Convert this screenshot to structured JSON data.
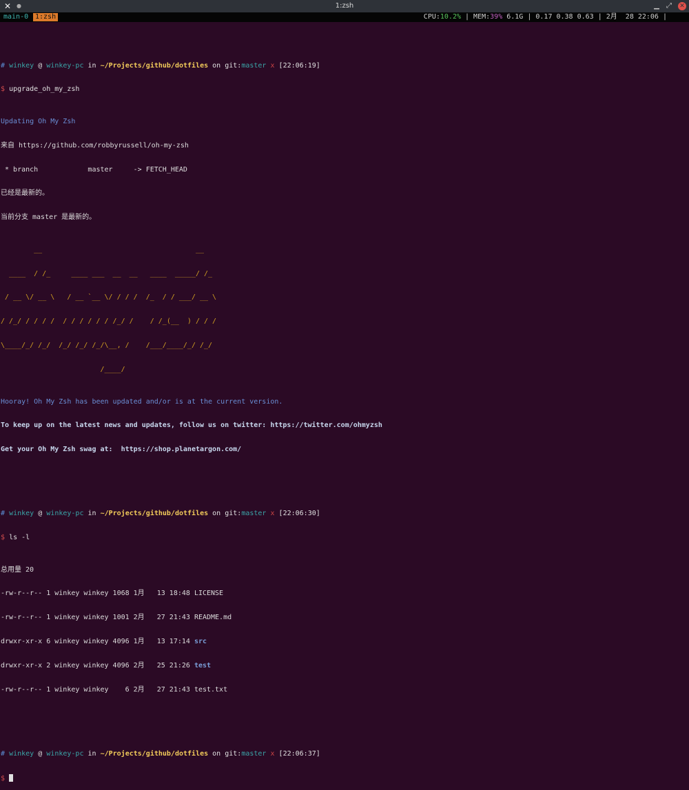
{
  "window": {
    "title": "1:zsh",
    "app_icon": "close-x-icon",
    "pin_icon": "dot-icon",
    "controls": [
      "minimize-icon",
      "restore-icon",
      "close-icon"
    ]
  },
  "tmux": {
    "session": "main-0",
    "window": "1:zsh",
    "cpu_label": "CPU:",
    "cpu_value": "10.2%",
    "mem_label": " | MEM:",
    "mem_value": "39%",
    "rest": " 6.1G | 0.17 0.38 0.63 | 2月  28 22:06 |"
  },
  "prompts": [
    {
      "hash": "#",
      "user": "winkey",
      "at": "@",
      "host": "winkey-pc",
      "in": "in",
      "path": "~/Projects/github/dotfiles",
      "on": "on",
      "git": "git:",
      "branch": "master",
      "dirty": "x",
      "time": "[22:06:19]",
      "cmd": "upgrade_oh_my_zsh"
    },
    {
      "hash": "#",
      "user": "winkey",
      "at": "@",
      "host": "winkey-pc",
      "in": "in",
      "path": "~/Projects/github/dotfiles",
      "on": "on",
      "git": "git:",
      "branch": "master",
      "dirty": "x",
      "time": "[22:06:30]",
      "cmd": "ls -l"
    },
    {
      "hash": "#",
      "user": "winkey",
      "at": "@",
      "host": "winkey-pc",
      "in": "in",
      "path": "~/Projects/github/dotfiles",
      "on": "on",
      "git": "git:",
      "branch": "master",
      "dirty": "x",
      "time": "[22:06:37]",
      "cmd": ""
    }
  ],
  "prompt_char": "$",
  "upgrade": {
    "updating": "Updating Oh My Zsh",
    "from": "来自 https://github.com/robbyrussell/oh-my-zsh",
    "branch": " * branch            master     -> FETCH_HEAD",
    "latest": "已经是最新的。",
    "current": "当前分支 master 是最新的。",
    "ascii": [
      "        __                                     __",
      "  ____  / /_     ____ ___  __  __   ____  _____/ /_",
      " / __ \\/ __ \\   / __ `__ \\/ / / /  /_  / / ___/ __ \\",
      "/ /_/ / / / /  / / / / / / /_/ /    / /_(__  ) / / /",
      "\\____/_/ /_/  /_/ /_/ /_/\\__, /    /___/____/_/ /_/",
      "                        /____/"
    ],
    "hooray": "Hooray! Oh My Zsh has been updated and/or is at the current version.",
    "twitter": "To keep up on the latest news and updates, follow us on twitter: https://twitter.com/ohmyzsh",
    "swag": "Get your Oh My Zsh swag at:  https://shop.planetargon.com/"
  },
  "ls": {
    "total": "总用量 20",
    "rows": [
      {
        "meta": "-rw-r--r-- 1 winkey winkey 1068 1月   13 18:48 ",
        "name": "LICENSE",
        "dir": false
      },
      {
        "meta": "-rw-r--r-- 1 winkey winkey 1001 2月   27 21:43 ",
        "name": "README.md",
        "dir": false
      },
      {
        "meta": "drwxr-xr-x 6 winkey winkey 4096 1月   13 17:14 ",
        "name": "src",
        "dir": true
      },
      {
        "meta": "drwxr-xr-x 2 winkey winkey 4096 2月   25 21:26 ",
        "name": "test",
        "dir": true
      },
      {
        "meta": "-rw-r--r-- 1 winkey winkey    6 2月   27 21:43 ",
        "name": "test.txt",
        "dir": false
      }
    ]
  }
}
